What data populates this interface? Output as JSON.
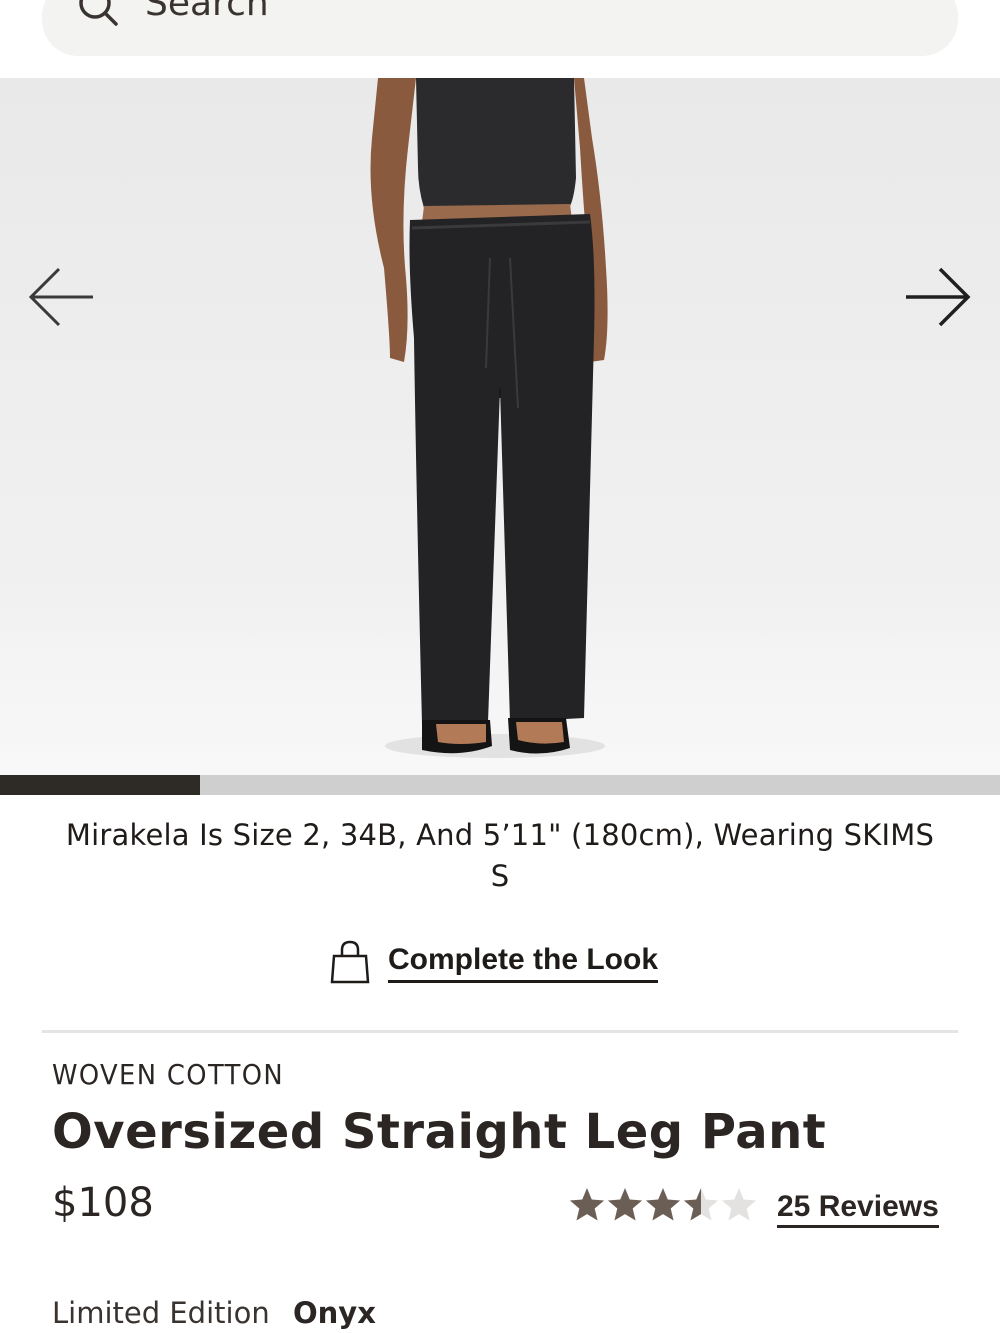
{
  "search": {
    "placeholder": "Search"
  },
  "gallery": {
    "prev_icon": "arrow-left-icon",
    "next_icon": "arrow-right-icon",
    "progress": 0.2
  },
  "model_caption": "Mirakela Is Size 2, 34B, And 5’11\" (180cm), Wearing SKIMS S",
  "complete_the_look": {
    "icon": "shopping-bag-icon",
    "label": "Complete the Look"
  },
  "product": {
    "collection": "WOVEN COTTON",
    "title": "Oversized Straight Leg Pant",
    "price": "$108",
    "rating": 3.5,
    "rating_max": 5,
    "reviews_label": "25 Reviews",
    "edition": "Limited Edition",
    "color": "Onyx"
  },
  "colors": {
    "star_filled": "#6b5e55",
    "star_empty": "#e4e2e0",
    "progress_fill": "#2e2a25",
    "progress_track": "#cfcfcf"
  }
}
